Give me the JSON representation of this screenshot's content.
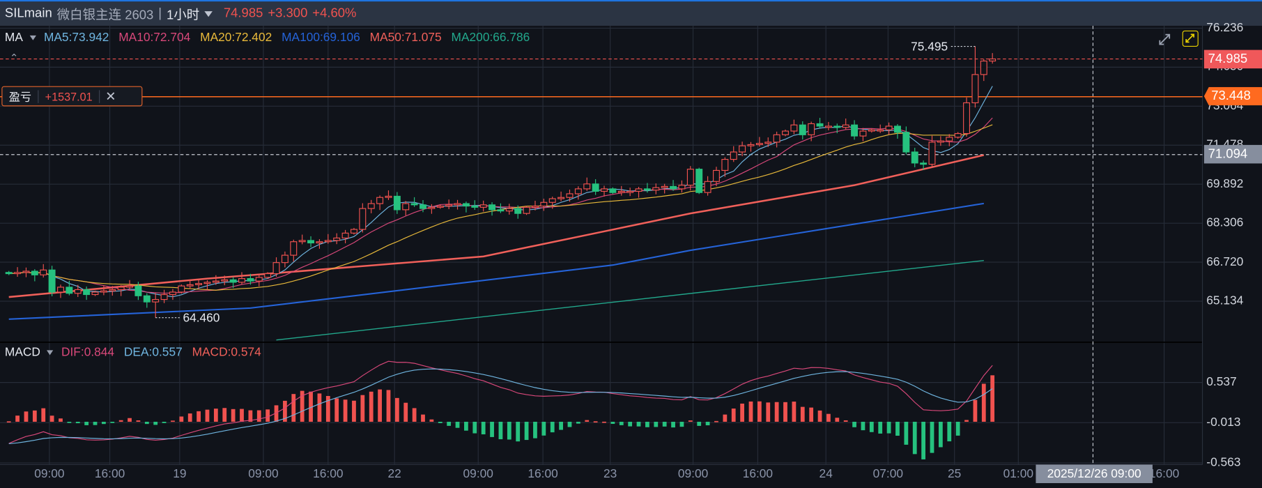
{
  "header": {
    "symbol": "SILmain",
    "name": "微白银主连 2603",
    "separator": "|",
    "timeframe": "1小时",
    "last": "74.985",
    "change": "+3.300",
    "change_pct": "+4.60%"
  },
  "ma_legend": {
    "label": "MA",
    "items": [
      {
        "text": "MA5:73.942",
        "color": "#6fb5e0"
      },
      {
        "text": "MA10:72.704",
        "color": "#d9487a"
      },
      {
        "text": "MA20:72.402",
        "color": "#e8b93a"
      },
      {
        "text": "MA100:69.106",
        "color": "#2563d8"
      },
      {
        "text": "MA50:71.075",
        "color": "#f0605a"
      },
      {
        "text": "MA200:66.786",
        "color": "#22a88c"
      }
    ]
  },
  "macd_legend": {
    "label": "MACD",
    "items": [
      {
        "text": "DIF:0.844",
        "color": "#d9487a"
      },
      {
        "text": "DEA:0.557",
        "color": "#6fb5e0"
      },
      {
        "text": "MACD:0.574",
        "color": "#f0605a"
      }
    ]
  },
  "pnl": {
    "label": "盈亏",
    "value": "+1537.01",
    "close": "✕"
  },
  "price_axis": [
    "76.236",
    "74.650",
    "73.064",
    "71.478",
    "69.892",
    "68.306",
    "66.720",
    "65.134"
  ],
  "macd_axis": [
    "0.537",
    "-0.013",
    "-0.563"
  ],
  "tags": {
    "last": "74.985",
    "position": "73.448",
    "crosshair": "71.094"
  },
  "time_axis": [
    {
      "label": "09:00",
      "i": 4.7
    },
    {
      "label": "16:00",
      "i": 11.7
    },
    {
      "label": "19",
      "i": 19.8
    },
    {
      "label": "09:00",
      "i": 29.5
    },
    {
      "label": "16:00",
      "i": 37
    },
    {
      "label": "22",
      "i": 44.7
    },
    {
      "label": "09:00",
      "i": 54.4
    },
    {
      "label": "16:00",
      "i": 61.9
    },
    {
      "label": "23",
      "i": 69.7
    },
    {
      "label": "09:00",
      "i": 79.3
    },
    {
      "label": "16:00",
      "i": 86.8
    },
    {
      "label": "24",
      "i": 94.7
    },
    {
      "label": "07:00",
      "i": 101.9
    },
    {
      "label": "25",
      "i": 109.6
    },
    {
      "label": "01:00",
      "i": 117
    },
    {
      "label": "16:00",
      "i": 133.9
    }
  ],
  "crosshair_time": "2025/12/26 09:00",
  "colors": {
    "up": "#f0524f",
    "down": "#26c27f",
    "position": "#ff6a1f",
    "crosshair": "#868e9e"
  },
  "chart_data": {
    "type": "candlestick",
    "price_range": [
      63.5,
      76.236
    ],
    "closes": [
      66.25,
      66.3,
      66.35,
      66.2,
      66.4,
      65.5,
      65.7,
      65.45,
      65.6,
      65.4,
      65.5,
      65.55,
      65.6,
      65.7,
      65.75,
      65.35,
      65.1,
      65.2,
      65.4,
      65.5,
      65.75,
      65.8,
      65.85,
      65.9,
      65.95,
      66.0,
      65.9,
      66.05,
      65.95,
      66.1,
      66.25,
      66.7,
      67.0,
      67.55,
      67.6,
      67.5,
      67.55,
      67.6,
      67.7,
      67.9,
      68.05,
      68.9,
      69.1,
      69.35,
      69.4,
      68.85,
      69.1,
      69.05,
      68.9,
      68.95,
      69.0,
      69.05,
      69.1,
      69.0,
      68.95,
      69.05,
      68.85,
      68.8,
      68.9,
      68.7,
      68.95,
      69.0,
      69.15,
      69.3,
      69.35,
      69.5,
      69.7,
      69.9,
      69.6,
      69.7,
      69.55,
      69.6,
      69.6,
      69.7,
      69.65,
      69.75,
      69.8,
      69.7,
      69.85,
      70.5,
      69.55,
      70.0,
      70.45,
      70.9,
      71.2,
      71.45,
      71.5,
      71.55,
      71.6,
      71.9,
      72.05,
      72.3,
      71.9,
      72.35,
      72.25,
      72.25,
      72.2,
      72.3,
      71.85,
      72.05,
      72.1,
      72.1,
      72.25,
      72.0,
      71.2,
      70.75,
      70.7,
      71.6,
      71.65,
      71.8,
      71.95,
      73.2,
      74.35,
      74.9,
      74.985
    ],
    "first_open": 66.3,
    "low_marker": {
      "label": "64.460",
      "value": 64.46,
      "index": 17
    },
    "high_marker": {
      "label": "75.495",
      "value": 75.495,
      "index": 112
    },
    "ma_long": [
      {
        "name": "MA50",
        "color": "#f0605a",
        "points": [
          [
            0,
            65.3
          ],
          [
            23,
            66.05
          ],
          [
            55,
            66.95
          ],
          [
            79,
            68.7
          ],
          [
            98,
            69.85
          ],
          [
            113,
            71.075
          ]
        ]
      },
      {
        "name": "MA100",
        "color": "#2563d8",
        "points": [
          [
            0,
            64.4
          ],
          [
            28,
            64.85
          ],
          [
            70,
            66.6
          ],
          [
            79,
            67.2
          ],
          [
            113,
            69.106
          ]
        ]
      },
      {
        "name": "MA200",
        "color": "#22a88c",
        "points": [
          [
            31,
            63.55
          ],
          [
            113,
            66.786
          ]
        ]
      }
    ],
    "position_price": 73.448,
    "crosshair_price": 71.094,
    "macd_range": [
      -0.563,
      0.537
    ]
  }
}
